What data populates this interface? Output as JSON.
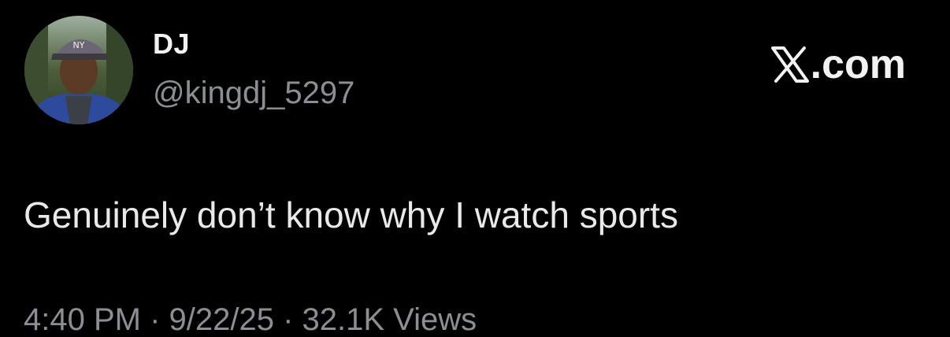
{
  "tweet": {
    "author": {
      "name": "DJ",
      "handle": "@kingdj_5297",
      "avatar_icon": "profile-photo"
    },
    "brand": {
      "icon": "x-logo-icon",
      "suffix": ".com"
    },
    "text": "Genuinely don’t know why I watch sports",
    "meta_partial": "4:40 PM · 9/22/25 · 32.1K Views"
  },
  "colors": {
    "background": "#000000",
    "primary_text": "#e7e9ea",
    "secondary_text": "#8b8f94"
  }
}
